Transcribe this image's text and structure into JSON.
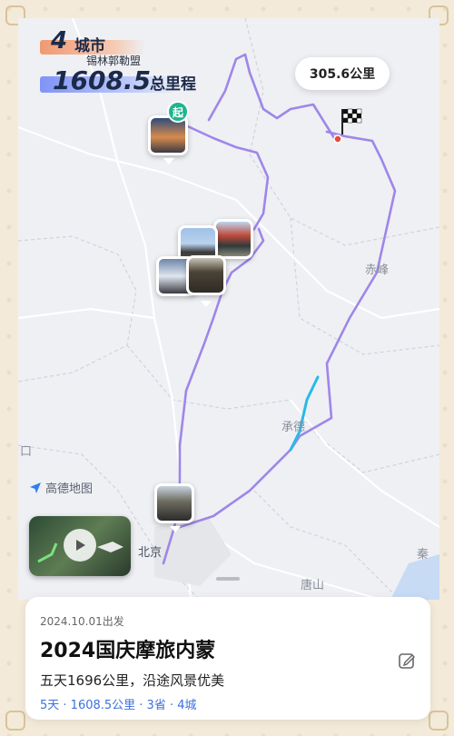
{
  "stats": {
    "city_count": "4",
    "city_label": "城市",
    "city_name": "锡林郭勒盟",
    "total_distance": "1608.5",
    "total_distance_label": "总里程"
  },
  "map": {
    "distance_bubble": "305.6公里",
    "start_badge": "起",
    "places": {
      "chifeng": "赤峰",
      "chengde": "承德",
      "beijing": "北京",
      "tangshan": "唐山",
      "qinhuangdao": "秦",
      "kou": "口"
    },
    "logo": "高德地图",
    "route_color": "#9f86e8",
    "highlight_color": "#2bb8e8"
  },
  "trip": {
    "date": "2024.10.01出发",
    "title": "2024国庆摩旅内蒙",
    "description": "五天1696公里，沿途风景优美",
    "meta": "5天 · 1608.5公里 · 3省 · 4城"
  },
  "icons": {
    "finish": "checkered-flag-icon",
    "play": "play-icon",
    "edit": "edit-icon",
    "logo": "amap-logo-icon"
  }
}
